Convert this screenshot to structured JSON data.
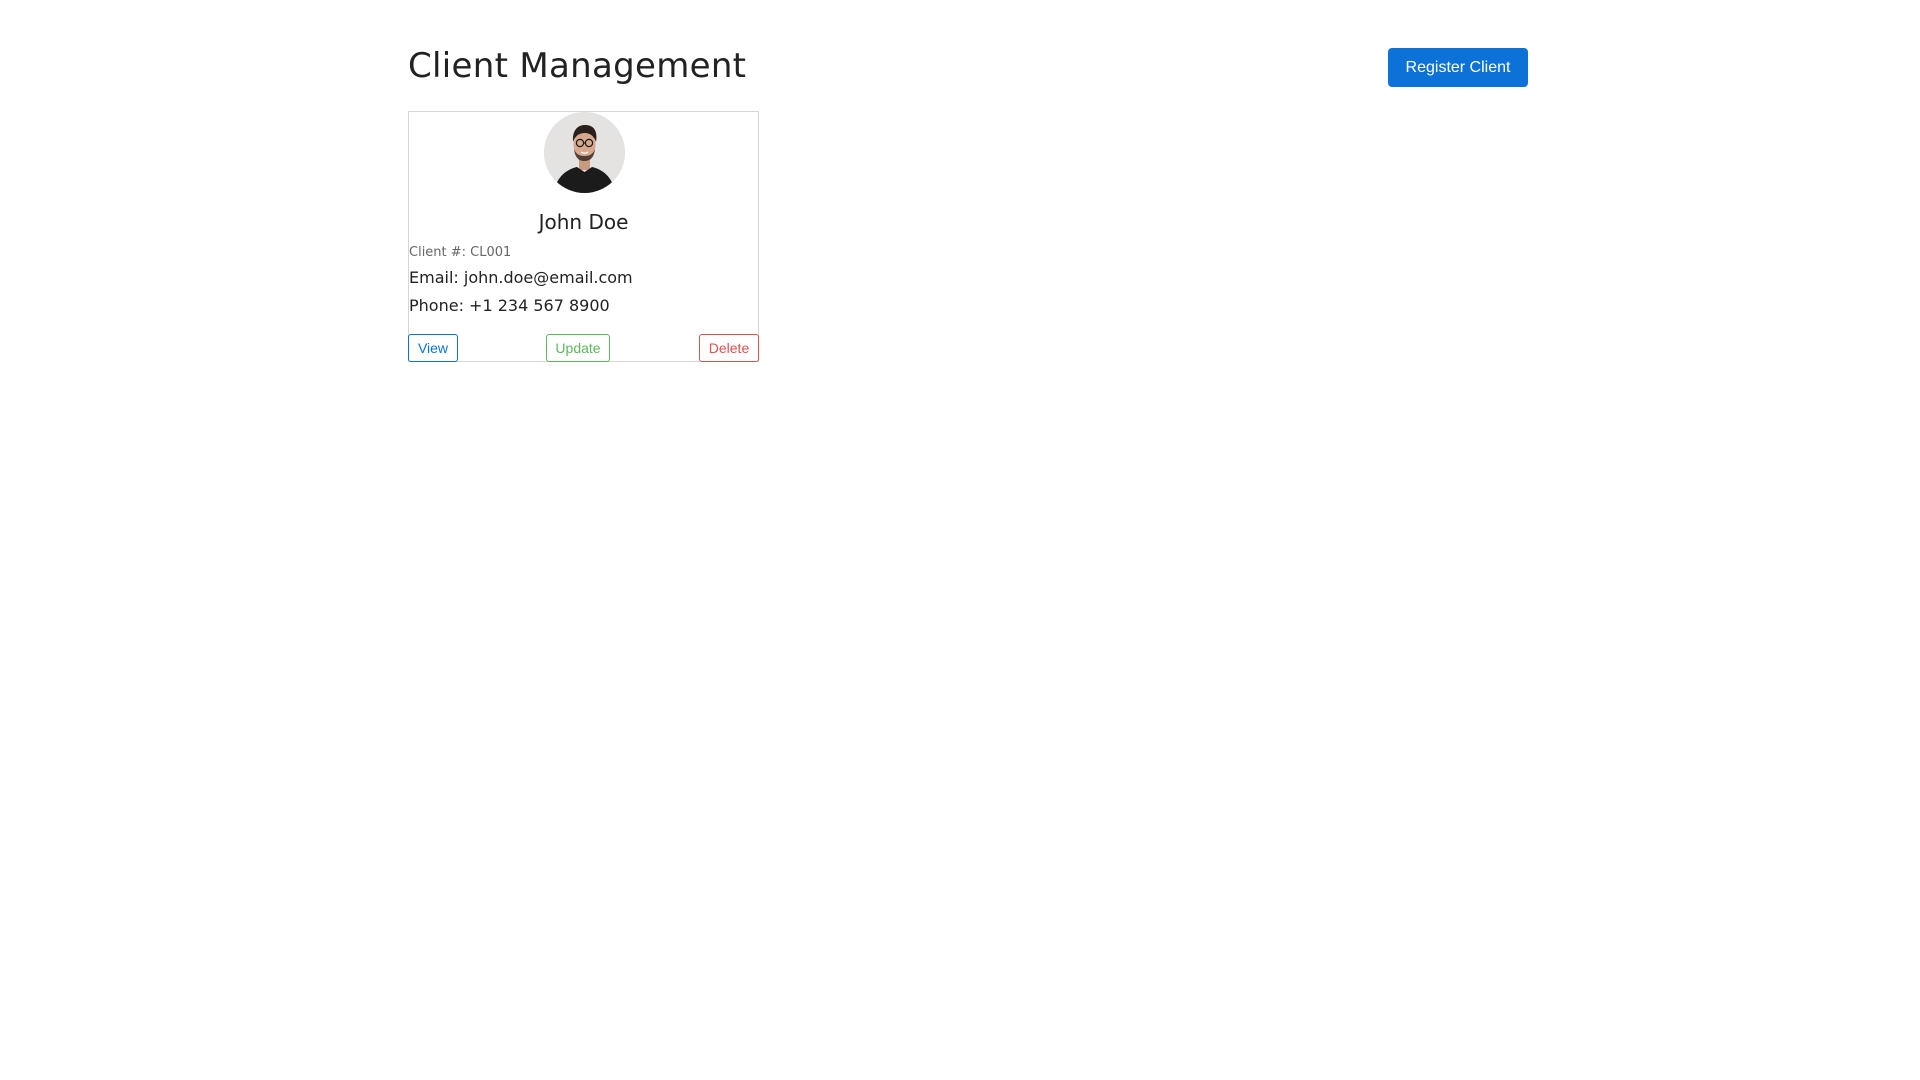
{
  "header": {
    "title": "Client Management",
    "register_label": "Register Client"
  },
  "client": {
    "name": "John Doe",
    "number": "Client #: CL001",
    "email": "Email: john.doe@email.com",
    "phone": "Phone: +1 234 567 8900",
    "avatar_icon": "person-avatar"
  },
  "actions": {
    "view_label": "View",
    "update_label": "Update",
    "delete_label": "Delete"
  },
  "colors": {
    "primary": "#0d72d8",
    "success": "#5cb85c",
    "danger": "#d9534f"
  }
}
